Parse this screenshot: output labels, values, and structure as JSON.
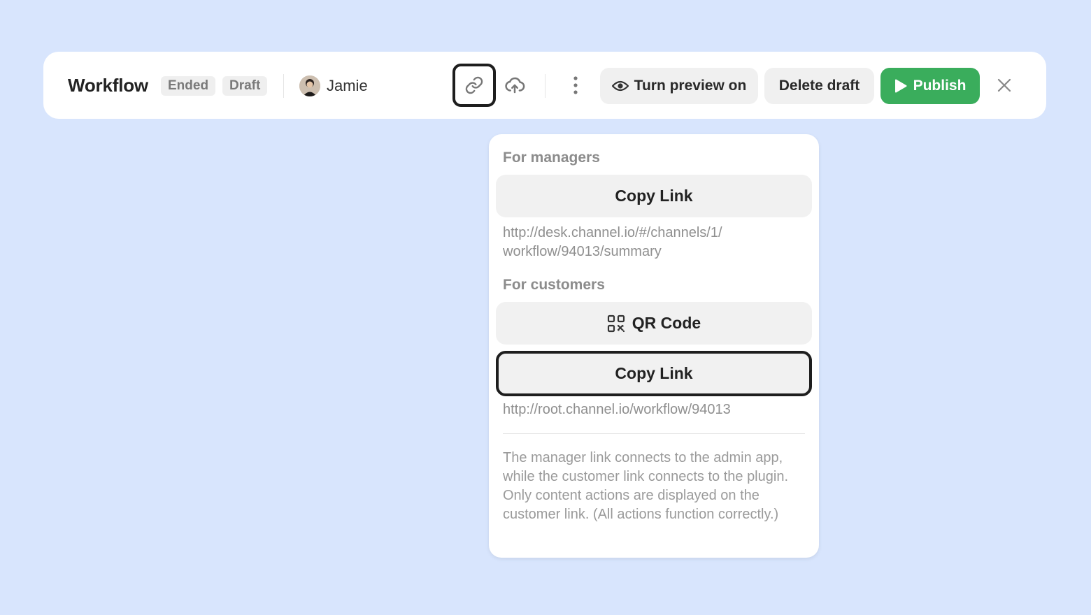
{
  "toolbar": {
    "title": "Workflow",
    "badges": [
      "Ended",
      "Draft"
    ],
    "user": {
      "name": "Jamie"
    },
    "icons": {
      "link": "link-icon",
      "upload": "cloud-upload-icon",
      "more": "more-vertical-icon",
      "close": "close-icon"
    },
    "preview_label": "Turn preview on",
    "delete_label": "Delete draft",
    "publish_label": "Publish",
    "colors": {
      "publish_bg": "#3aad5c",
      "background": "#d8e5fd"
    }
  },
  "popover": {
    "managers": {
      "title": "For managers",
      "copy_label": "Copy Link",
      "url_line1": "http://desk.channel.io/#/channels/1/",
      "url_line2": "workflow/94013/summary"
    },
    "customers": {
      "title": "For customers",
      "qr_label": "QR Code",
      "copy_label": "Copy Link",
      "url": "http://root.channel.io/workflow/94013"
    },
    "note": "The manager link connects to the admin app, while the customer link connects to the plugin. Only content actions are displayed on the customer link. (All actions function correctly.)"
  }
}
